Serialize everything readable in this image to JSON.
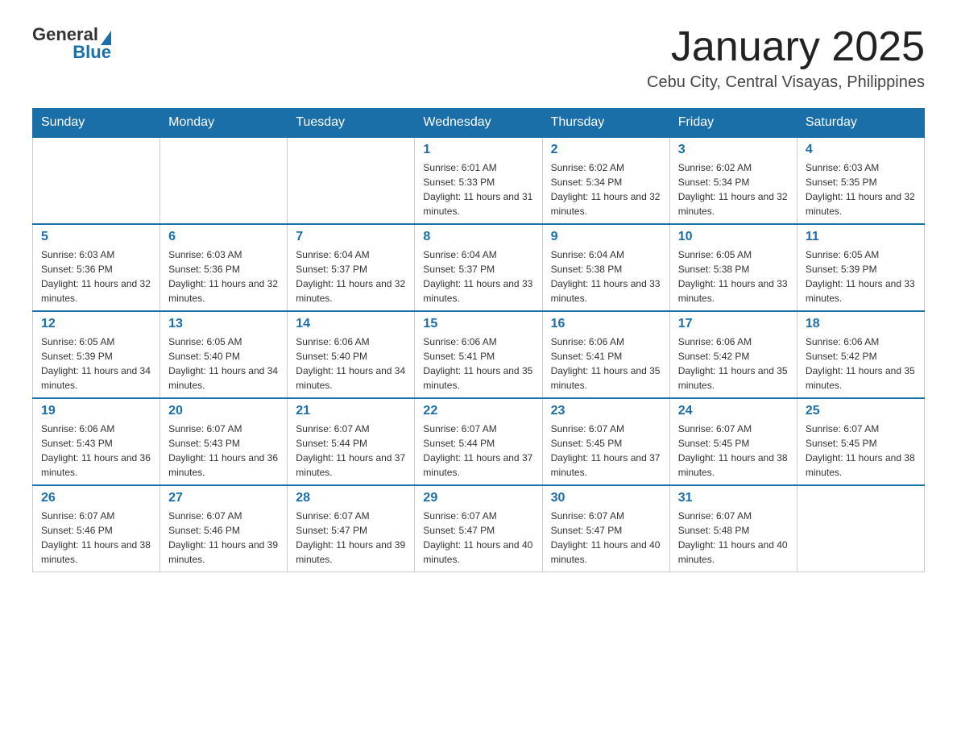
{
  "header": {
    "logo_general": "General",
    "logo_blue": "Blue",
    "month_title": "January 2025",
    "location": "Cebu City, Central Visayas, Philippines"
  },
  "weekdays": [
    "Sunday",
    "Monday",
    "Tuesday",
    "Wednesday",
    "Thursday",
    "Friday",
    "Saturday"
  ],
  "weeks": [
    {
      "days": [
        {
          "number": "",
          "sunrise": "",
          "sunset": "",
          "daylight": ""
        },
        {
          "number": "",
          "sunrise": "",
          "sunset": "",
          "daylight": ""
        },
        {
          "number": "",
          "sunrise": "",
          "sunset": "",
          "daylight": ""
        },
        {
          "number": "1",
          "sunrise": "Sunrise: 6:01 AM",
          "sunset": "Sunset: 5:33 PM",
          "daylight": "Daylight: 11 hours and 31 minutes."
        },
        {
          "number": "2",
          "sunrise": "Sunrise: 6:02 AM",
          "sunset": "Sunset: 5:34 PM",
          "daylight": "Daylight: 11 hours and 32 minutes."
        },
        {
          "number": "3",
          "sunrise": "Sunrise: 6:02 AM",
          "sunset": "Sunset: 5:34 PM",
          "daylight": "Daylight: 11 hours and 32 minutes."
        },
        {
          "number": "4",
          "sunrise": "Sunrise: 6:03 AM",
          "sunset": "Sunset: 5:35 PM",
          "daylight": "Daylight: 11 hours and 32 minutes."
        }
      ]
    },
    {
      "days": [
        {
          "number": "5",
          "sunrise": "Sunrise: 6:03 AM",
          "sunset": "Sunset: 5:36 PM",
          "daylight": "Daylight: 11 hours and 32 minutes."
        },
        {
          "number": "6",
          "sunrise": "Sunrise: 6:03 AM",
          "sunset": "Sunset: 5:36 PM",
          "daylight": "Daylight: 11 hours and 32 minutes."
        },
        {
          "number": "7",
          "sunrise": "Sunrise: 6:04 AM",
          "sunset": "Sunset: 5:37 PM",
          "daylight": "Daylight: 11 hours and 32 minutes."
        },
        {
          "number": "8",
          "sunrise": "Sunrise: 6:04 AM",
          "sunset": "Sunset: 5:37 PM",
          "daylight": "Daylight: 11 hours and 33 minutes."
        },
        {
          "number": "9",
          "sunrise": "Sunrise: 6:04 AM",
          "sunset": "Sunset: 5:38 PM",
          "daylight": "Daylight: 11 hours and 33 minutes."
        },
        {
          "number": "10",
          "sunrise": "Sunrise: 6:05 AM",
          "sunset": "Sunset: 5:38 PM",
          "daylight": "Daylight: 11 hours and 33 minutes."
        },
        {
          "number": "11",
          "sunrise": "Sunrise: 6:05 AM",
          "sunset": "Sunset: 5:39 PM",
          "daylight": "Daylight: 11 hours and 33 minutes."
        }
      ]
    },
    {
      "days": [
        {
          "number": "12",
          "sunrise": "Sunrise: 6:05 AM",
          "sunset": "Sunset: 5:39 PM",
          "daylight": "Daylight: 11 hours and 34 minutes."
        },
        {
          "number": "13",
          "sunrise": "Sunrise: 6:05 AM",
          "sunset": "Sunset: 5:40 PM",
          "daylight": "Daylight: 11 hours and 34 minutes."
        },
        {
          "number": "14",
          "sunrise": "Sunrise: 6:06 AM",
          "sunset": "Sunset: 5:40 PM",
          "daylight": "Daylight: 11 hours and 34 minutes."
        },
        {
          "number": "15",
          "sunrise": "Sunrise: 6:06 AM",
          "sunset": "Sunset: 5:41 PM",
          "daylight": "Daylight: 11 hours and 35 minutes."
        },
        {
          "number": "16",
          "sunrise": "Sunrise: 6:06 AM",
          "sunset": "Sunset: 5:41 PM",
          "daylight": "Daylight: 11 hours and 35 minutes."
        },
        {
          "number": "17",
          "sunrise": "Sunrise: 6:06 AM",
          "sunset": "Sunset: 5:42 PM",
          "daylight": "Daylight: 11 hours and 35 minutes."
        },
        {
          "number": "18",
          "sunrise": "Sunrise: 6:06 AM",
          "sunset": "Sunset: 5:42 PM",
          "daylight": "Daylight: 11 hours and 35 minutes."
        }
      ]
    },
    {
      "days": [
        {
          "number": "19",
          "sunrise": "Sunrise: 6:06 AM",
          "sunset": "Sunset: 5:43 PM",
          "daylight": "Daylight: 11 hours and 36 minutes."
        },
        {
          "number": "20",
          "sunrise": "Sunrise: 6:07 AM",
          "sunset": "Sunset: 5:43 PM",
          "daylight": "Daylight: 11 hours and 36 minutes."
        },
        {
          "number": "21",
          "sunrise": "Sunrise: 6:07 AM",
          "sunset": "Sunset: 5:44 PM",
          "daylight": "Daylight: 11 hours and 37 minutes."
        },
        {
          "number": "22",
          "sunrise": "Sunrise: 6:07 AM",
          "sunset": "Sunset: 5:44 PM",
          "daylight": "Daylight: 11 hours and 37 minutes."
        },
        {
          "number": "23",
          "sunrise": "Sunrise: 6:07 AM",
          "sunset": "Sunset: 5:45 PM",
          "daylight": "Daylight: 11 hours and 37 minutes."
        },
        {
          "number": "24",
          "sunrise": "Sunrise: 6:07 AM",
          "sunset": "Sunset: 5:45 PM",
          "daylight": "Daylight: 11 hours and 38 minutes."
        },
        {
          "number": "25",
          "sunrise": "Sunrise: 6:07 AM",
          "sunset": "Sunset: 5:45 PM",
          "daylight": "Daylight: 11 hours and 38 minutes."
        }
      ]
    },
    {
      "days": [
        {
          "number": "26",
          "sunrise": "Sunrise: 6:07 AM",
          "sunset": "Sunset: 5:46 PM",
          "daylight": "Daylight: 11 hours and 38 minutes."
        },
        {
          "number": "27",
          "sunrise": "Sunrise: 6:07 AM",
          "sunset": "Sunset: 5:46 PM",
          "daylight": "Daylight: 11 hours and 39 minutes."
        },
        {
          "number": "28",
          "sunrise": "Sunrise: 6:07 AM",
          "sunset": "Sunset: 5:47 PM",
          "daylight": "Daylight: 11 hours and 39 minutes."
        },
        {
          "number": "29",
          "sunrise": "Sunrise: 6:07 AM",
          "sunset": "Sunset: 5:47 PM",
          "daylight": "Daylight: 11 hours and 40 minutes."
        },
        {
          "number": "30",
          "sunrise": "Sunrise: 6:07 AM",
          "sunset": "Sunset: 5:47 PM",
          "daylight": "Daylight: 11 hours and 40 minutes."
        },
        {
          "number": "31",
          "sunrise": "Sunrise: 6:07 AM",
          "sunset": "Sunset: 5:48 PM",
          "daylight": "Daylight: 11 hours and 40 minutes."
        },
        {
          "number": "",
          "sunrise": "",
          "sunset": "",
          "daylight": ""
        }
      ]
    }
  ]
}
